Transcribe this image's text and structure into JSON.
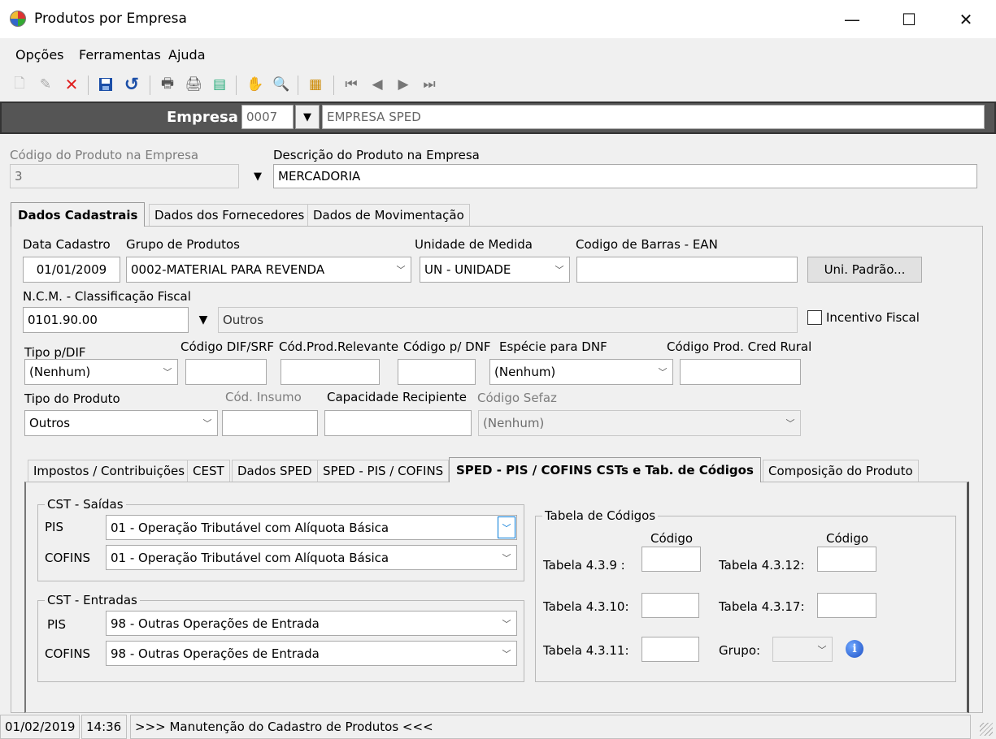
{
  "window": {
    "title": "Produtos por Empresa",
    "minimize": "—",
    "maximize": "☐",
    "close": "✕"
  },
  "menu": [
    "Opções",
    "Ferramentas",
    "Ajuda"
  ],
  "empresa": {
    "label": "Empresa",
    "code": "0007",
    "name": "EMPRESA SPED"
  },
  "produto": {
    "code_label": "Código do Produto na Empresa",
    "code_value": "3",
    "desc_label": "Descrição do Produto na Empresa",
    "desc_value": "MERCADORIA"
  },
  "main_tabs": [
    "Dados Cadastrais",
    "Dados dos Fornecedores",
    "Dados de Movimentação"
  ],
  "cadastro": {
    "data_label": "Data Cadastro",
    "data_value": "01/01/2009",
    "grupo_label": "Grupo de Produtos",
    "grupo_value": "0002-MATERIAL PARA REVENDA",
    "unidade_label": "Unidade de Medida",
    "unidade_value": "UN - UNIDADE",
    "ean_label": "Codigo de Barras - EAN",
    "ean_value": "",
    "uni_padrao_button": "Uni. Padrão...",
    "ncm_label": "N.C.M. -  Classificação Fiscal",
    "ncm_value": "0101.90.00",
    "ncm_desc": "Outros",
    "incentivo_label": "Incentivo Fiscal",
    "tipo_dif_label": "Tipo p/DIF",
    "tipo_dif_value": "(Nenhum)",
    "cod_dif_label": "Código DIF/SRF",
    "cod_prod_rel_label": "Cód.Prod.Relevante",
    "cod_dnf_label": "Código p/ DNF",
    "especie_dnf_label": "Espécie para DNF",
    "especie_dnf_value": "(Nenhum)",
    "cod_cred_rural_label": "Código Prod. Cred Rural",
    "tipo_prod_label": "Tipo do Produto",
    "tipo_prod_value": "Outros",
    "cod_insumo_label": "Cód. Insumo",
    "capacidade_label": "Capacidade Recipiente",
    "cod_sefaz_label": "Código Sefaz",
    "cod_sefaz_value": "(Nenhum)"
  },
  "sub_tabs": [
    "Impostos / Contribuições",
    "CEST",
    "Dados SPED",
    "SPED - PIS / COFINS",
    "SPED - PIS / COFINS CSTs e Tab. de Códigos",
    "Composição do Produto"
  ],
  "cst_saidas": {
    "legend": "CST - Saídas",
    "pis_label": "PIS",
    "pis_value": "01 - Operação Tributável com Alíquota Básica",
    "cofins_label": "COFINS",
    "cofins_value": "01 - Operação Tributável com Alíquota Básica"
  },
  "cst_entradas": {
    "legend": "CST - Entradas",
    "pis_label": "PIS",
    "pis_value": "98 - Outras Operações de Entrada",
    "cofins_label": "COFINS",
    "cofins_value": "98 - Outras Operações de Entrada"
  },
  "tabela": {
    "legend": "Tabela de Códigos",
    "codigo_header": "Código",
    "t439": "Tabela 4.3.9 :",
    "t4310": "Tabela 4.3.10:",
    "t4311": "Tabela 4.3.11:",
    "t4312": "Tabela 4.3.12:",
    "t4317": "Tabela 4.3.17:",
    "grupo": "Grupo:"
  },
  "status": {
    "date": "01/02/2019",
    "time": "14:36",
    "message": ">>> Manutenção do Cadastro de Produtos <<<"
  }
}
